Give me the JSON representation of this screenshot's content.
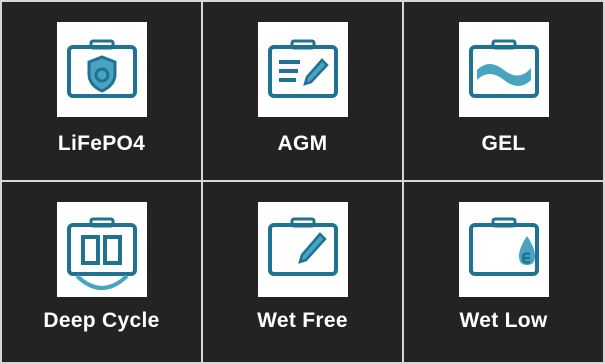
{
  "colors": {
    "background": "#232323",
    "grid_line": "#d6d6d6",
    "icon_stroke": "#1f7390",
    "icon_fill": "#4aa3c1"
  },
  "battery_types": [
    {
      "label": "LiFePO4",
      "icon": "battery-shield-icon"
    },
    {
      "label": "AGM",
      "icon": "battery-pen-lines-icon"
    },
    {
      "label": "GEL",
      "icon": "battery-wave-icon"
    },
    {
      "label": "Deep Cycle",
      "icon": "battery-deep-cycle-icon"
    },
    {
      "label": "Wet Free",
      "icon": "battery-pen-icon"
    },
    {
      "label": "Wet Low",
      "icon": "battery-drop-icon"
    }
  ]
}
